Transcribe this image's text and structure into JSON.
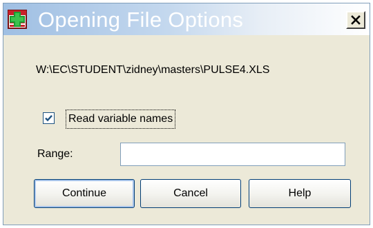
{
  "window": {
    "title": "Opening File Options",
    "close_glyph": "✕"
  },
  "file": {
    "path": "W:\\EC\\STUDENT\\zidney\\masters\\PULSE4.XLS"
  },
  "options": {
    "read_variable_names_label": "Read variable names",
    "read_variable_names_checked": true
  },
  "range": {
    "label": "Range:",
    "value": ""
  },
  "buttons": {
    "continue": "Continue",
    "cancel": "Cancel",
    "help": "Help"
  },
  "colors": {
    "titlebar_start": "#9fbfe3",
    "dialog_bg": "#ece9d8",
    "checkbox_accent": "#1c5180"
  },
  "icons": {
    "app": "spreadsheet-grid-icon",
    "close": "close-icon",
    "check": "checkmark-icon"
  }
}
